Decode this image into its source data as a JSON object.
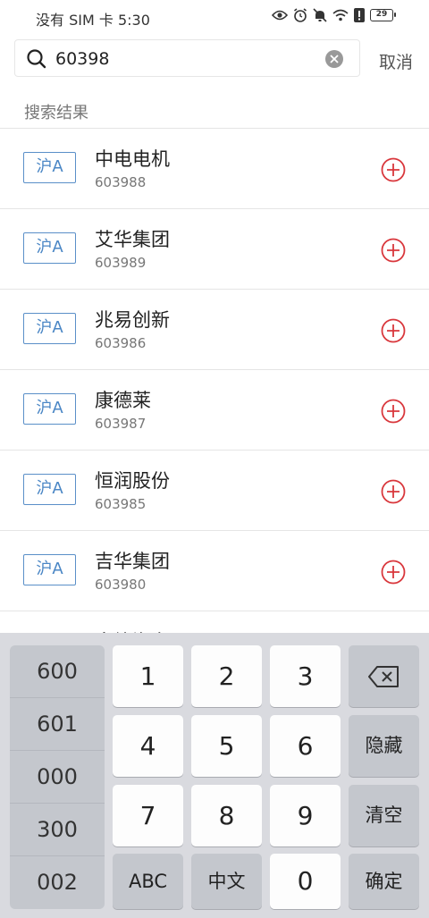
{
  "status": {
    "carrier_time": "没有 SIM 卡 5:30",
    "battery": "29"
  },
  "search": {
    "value": "60398",
    "cancel_label": "取消"
  },
  "section_title": "搜索结果",
  "results": [
    {
      "market": "沪A",
      "name": "中电电机",
      "code": "603988"
    },
    {
      "market": "沪A",
      "name": "艾华集团",
      "code": "603989"
    },
    {
      "market": "沪A",
      "name": "兆易创新",
      "code": "603986"
    },
    {
      "market": "沪A",
      "name": "康德莱",
      "code": "603987"
    },
    {
      "market": "沪A",
      "name": "恒润股份",
      "code": "603985"
    },
    {
      "market": "沪A",
      "name": "吉华集团",
      "code": "603980"
    }
  ],
  "partial_result": {
    "name": "皇峰海东"
  },
  "keyboard": {
    "prefixes": [
      "600",
      "601",
      "000",
      "300",
      "002"
    ],
    "keys": {
      "k1": "1",
      "k2": "2",
      "k3": "3",
      "k4": "4",
      "k5": "5",
      "k6": "6",
      "k7": "7",
      "k8": "8",
      "k9": "9",
      "abc": "ABC",
      "chinese": "中文",
      "k0": "0",
      "hide": "隐藏",
      "clear": "清空",
      "confirm": "确定"
    }
  }
}
